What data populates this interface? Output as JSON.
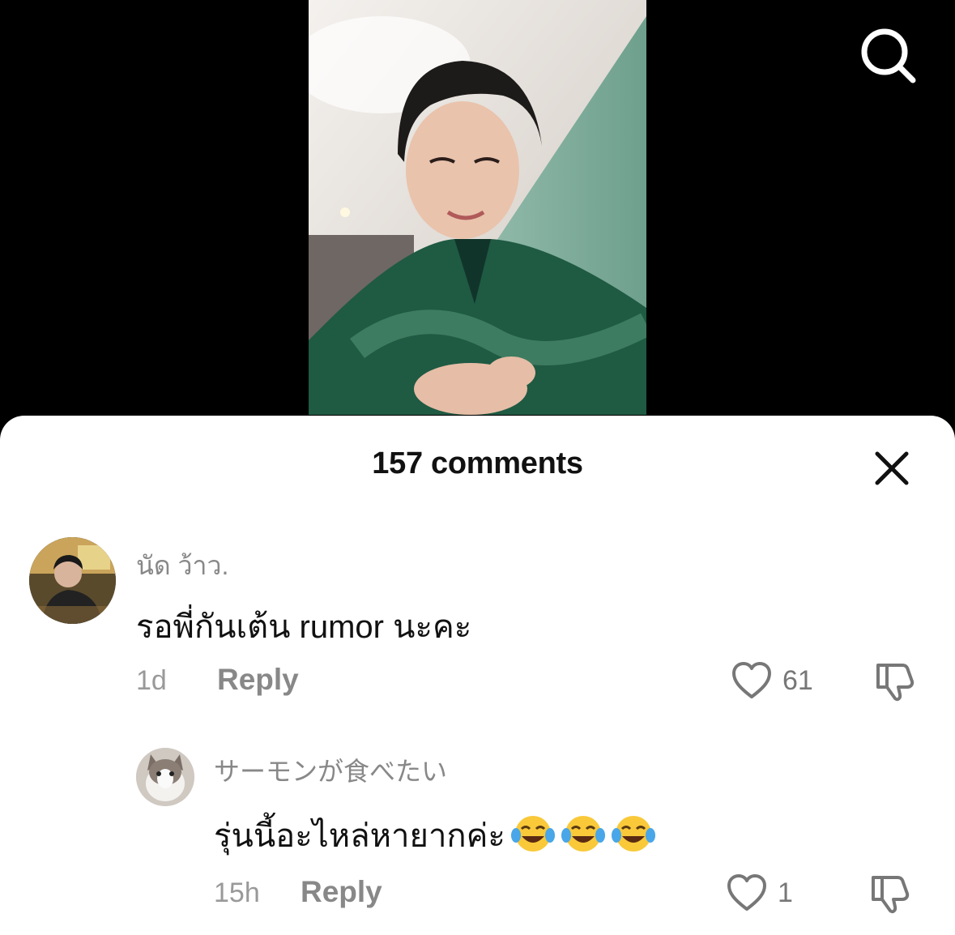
{
  "sheet": {
    "title": "157 comments"
  },
  "comments": [
    {
      "username": "นัด ว้าว.",
      "text": "รอพี่กันเต้น rumor นะคะ",
      "time": "1d",
      "reply_label": "Reply",
      "likes": "61"
    },
    {
      "username": "サーモンが食べたい",
      "text": "รุ่นนี้อะไหล่หายากค่ะ",
      "emojis": [
        "tears-of-joy",
        "tears-of-joy",
        "tears-of-joy"
      ],
      "time": "15h",
      "reply_label": "Reply",
      "likes": "1"
    }
  ],
  "icons": {
    "search": "search-icon",
    "close": "close-icon",
    "like": "heart-outline-icon",
    "dislike": "thumbs-down-icon"
  },
  "colors": {
    "sheet_bg": "#ffffff",
    "text": "#111111",
    "muted": "#888888"
  }
}
